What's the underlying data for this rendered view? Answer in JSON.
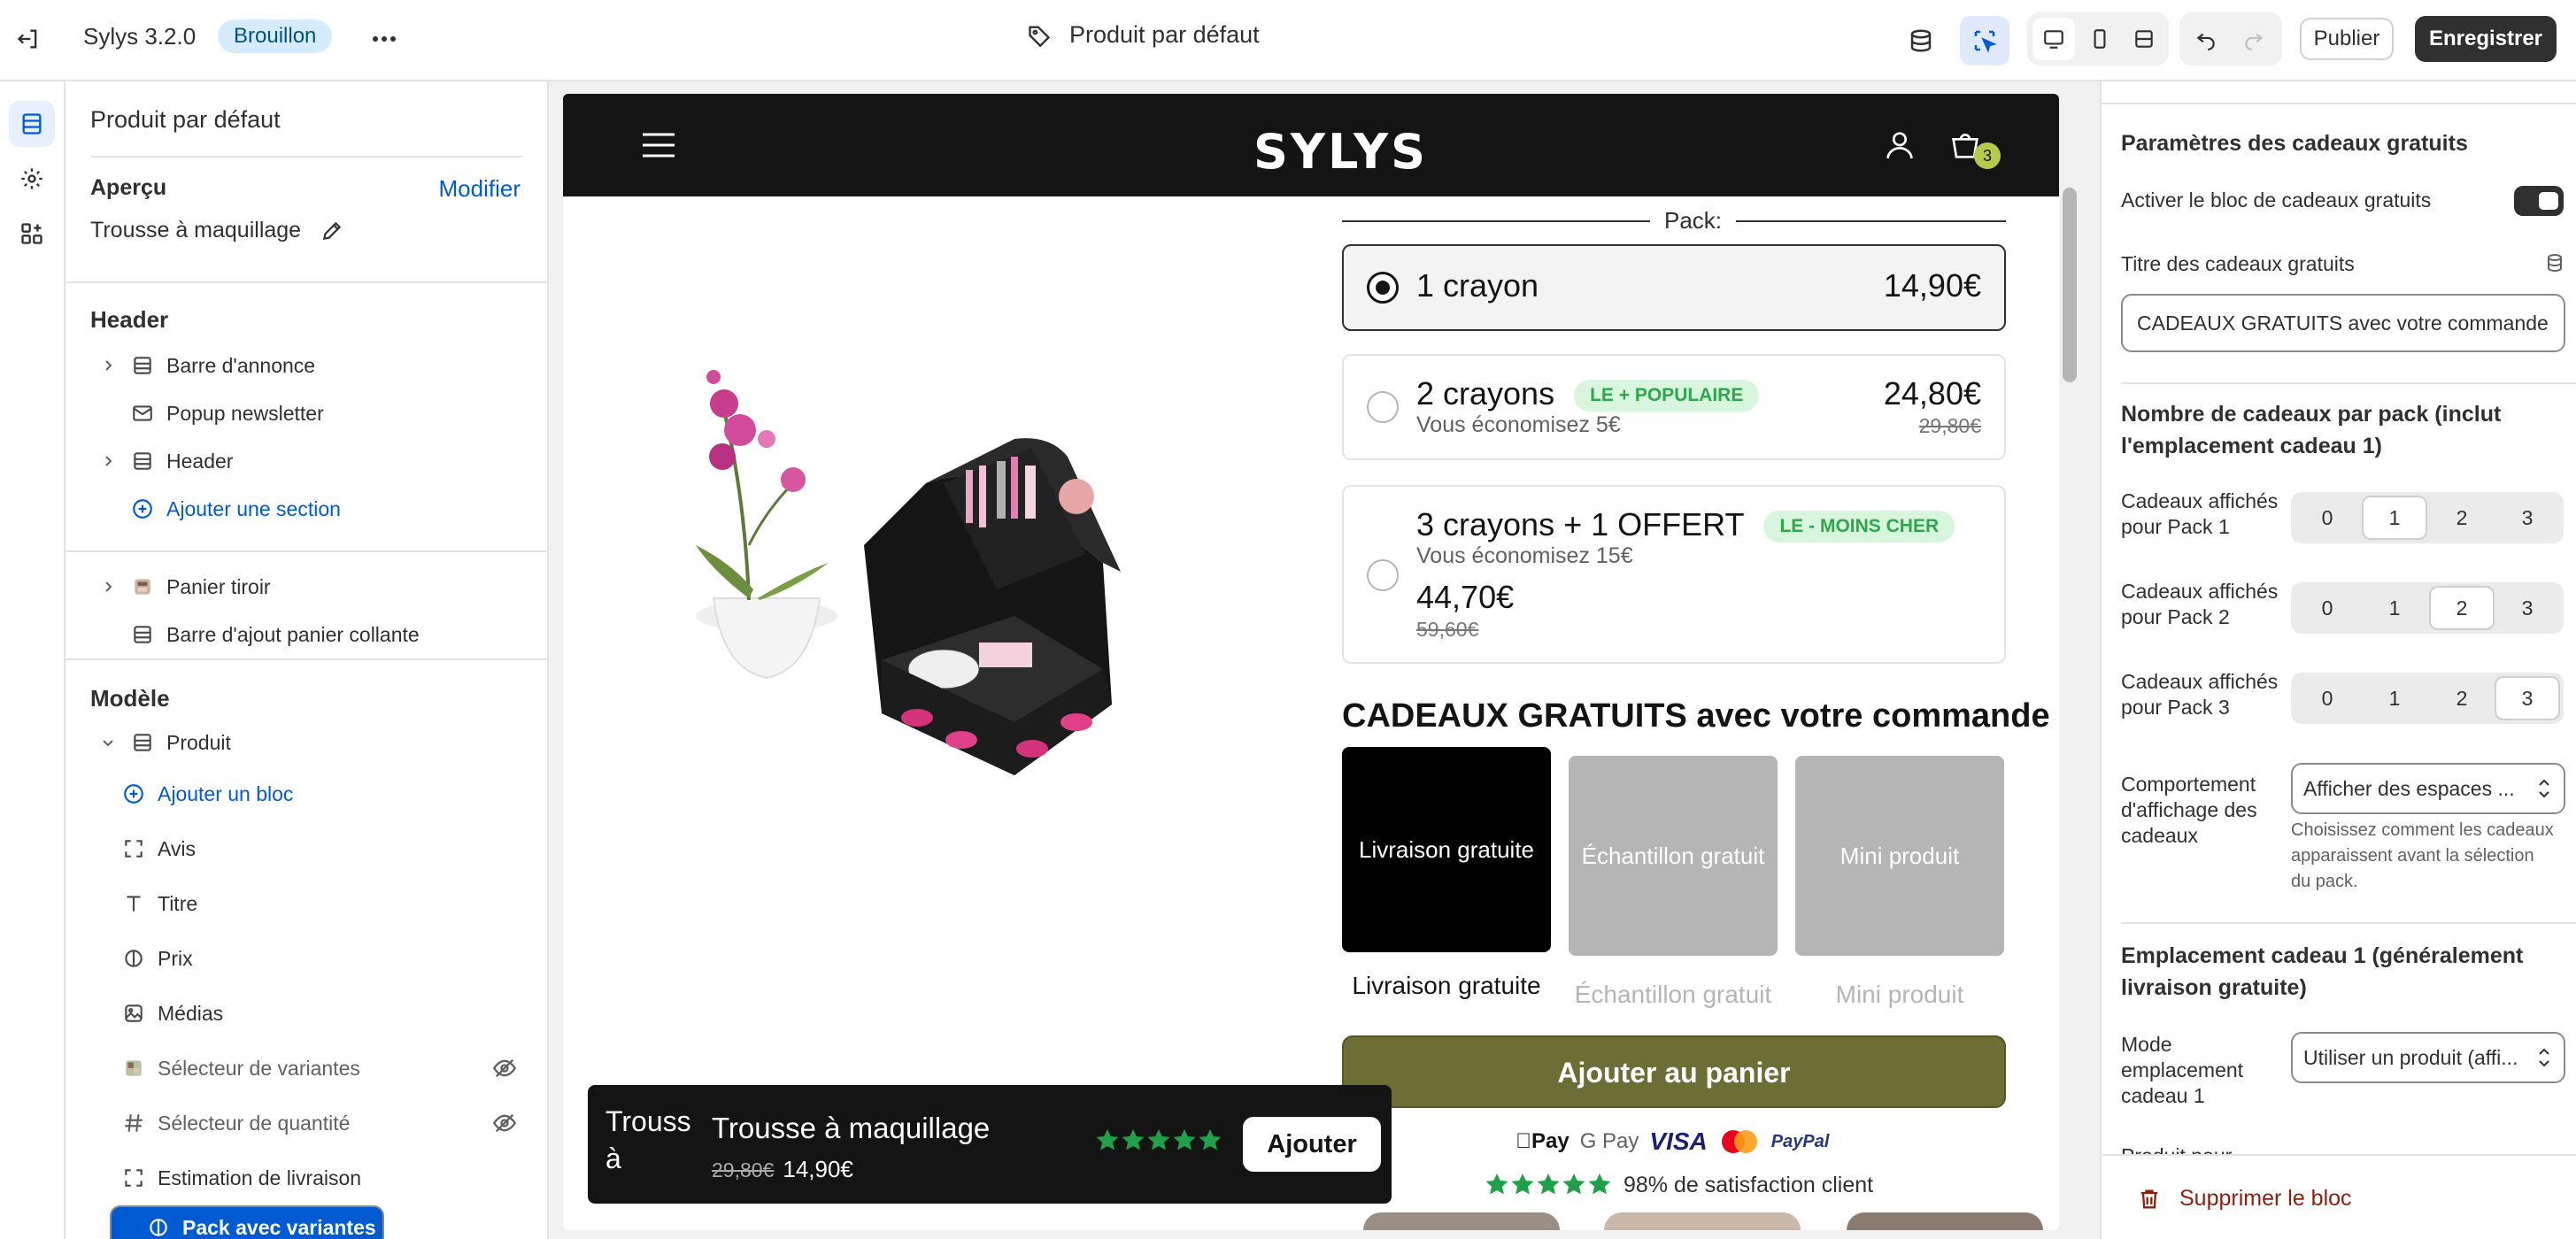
{
  "topbar": {
    "app_name": "Sylys 3.2.0",
    "status_badge": "Brouillon",
    "template_title": "Produit par défaut",
    "publish_label": "Publier",
    "save_label": "Enregistrer"
  },
  "sidebar": {
    "title": "Produit par défaut",
    "preview_heading": "Aperçu",
    "preview_modify": "Modifier",
    "preview_product": "Trousse à maquillage",
    "header_group": {
      "heading": "Header",
      "items": [
        {
          "label": "Barre d'annonce",
          "expandable": true,
          "icon": "section-icon"
        },
        {
          "label": "Popup newsletter",
          "expandable": false,
          "icon": "mail-icon"
        },
        {
          "label": "Header",
          "expandable": true,
          "icon": "section-icon"
        }
      ],
      "add_section": "Ajouter une section"
    },
    "extra_items": [
      {
        "label": "Panier tiroir",
        "expandable": true,
        "icon": "drawer-thumb-icon"
      },
      {
        "label": "Barre d'ajout panier collante",
        "expandable": false,
        "icon": "section-icon"
      }
    ],
    "template_group": {
      "heading": "Modèle",
      "product_label": "Produit",
      "add_block": "Ajouter un bloc",
      "blocks": [
        {
          "label": "Avis",
          "icon": "block-frame-icon",
          "hidden": false
        },
        {
          "label": "Titre",
          "icon": "text-icon",
          "hidden": false
        },
        {
          "label": "Prix",
          "icon": "price-tag-icon",
          "hidden": false
        },
        {
          "label": "Médias",
          "icon": "image-icon",
          "hidden": false
        },
        {
          "label": "Sélecteur de variantes",
          "icon": "variant-thumb-icon",
          "hidden": true
        },
        {
          "label": "Sélecteur de quantité",
          "icon": "hash-icon",
          "hidden": true
        },
        {
          "label": "Estimation de livraison",
          "icon": "block-frame-icon",
          "hidden": false
        },
        {
          "label": "Pack avec variantes",
          "icon": "price-tag-icon",
          "hidden": false,
          "selected": true
        }
      ]
    }
  },
  "preview": {
    "logo": "SYLYS",
    "cart_count": "3",
    "pack_label": "Pack:",
    "options": [
      {
        "title": "1 crayon",
        "price": "14,90€",
        "selected": true
      },
      {
        "title": "2 crayons",
        "tag": "LE + POPULAIRE",
        "subtitle": "Vous économisez 5€",
        "price": "24,80€",
        "old_price": "29,80€"
      },
      {
        "title": "3 crayons + 1 OFFERT",
        "tag": "LE - MOINS CHER",
        "subtitle": "Vous économisez 15€",
        "price": "44,70€",
        "old_price": "59,60€"
      }
    ],
    "gifts_title": "CADEAUX GRATUITS avec votre commande",
    "gifts": [
      {
        "label": "Livraison gratuite",
        "caption": "Livraison gratuite",
        "active": true
      },
      {
        "label": "Échantillon gratuit",
        "caption": "Échantillon gratuit",
        "active": false
      },
      {
        "label": "Mini produit",
        "caption": "Mini produit",
        "active": false
      }
    ],
    "add_to_cart": "Ajouter au panier",
    "payment_methods": [
      "Apple Pay",
      "G Pay",
      "VISA",
      "Mastercard",
      "PayPal"
    ],
    "satisfaction": "98% de satisfaction client",
    "sticky": {
      "short_title": "Trouss à",
      "product_name": "Trousse à maquillage",
      "old_price": "29,80€",
      "price": "14,90€",
      "rating": 5,
      "button": "Ajouter"
    }
  },
  "settings": {
    "section_title": "Paramètres des cadeaux gratuits",
    "enable_label": "Activer le bloc de cadeaux gratuits",
    "enable_value": true,
    "gifts_title_label": "Titre des cadeaux gratuits",
    "gifts_title_value": "CADEAUX GRATUITS avec votre commande",
    "per_pack_heading": "Nombre de cadeaux par pack (inclut l'emplacement cadeau 1)",
    "packs": [
      {
        "label": "Cadeaux affichés pour Pack 1",
        "options": [
          "0",
          "1",
          "2",
          "3"
        ],
        "selected": "1"
      },
      {
        "label": "Cadeaux affichés pour Pack 2",
        "options": [
          "0",
          "1",
          "2",
          "3"
        ],
        "selected": "2"
      },
      {
        "label": "Cadeaux affichés pour Pack 3",
        "options": [
          "0",
          "1",
          "2",
          "3"
        ],
        "selected": "3"
      }
    ],
    "display_label": "Comportement d'affichage des cadeaux",
    "display_value": "Afficher des espaces ...",
    "display_help": "Choisissez comment les cadeaux apparaissent avant la sélection du pack.",
    "slot1_heading": "Emplacement cadeau 1 (généralement livraison gratuite)",
    "slot1_mode_label": "Mode emplacement cadeau 1",
    "slot1_mode_value": "Utiliser un produit (affi...",
    "product_for_label": "Produit pour",
    "delete_label": "Supprimer le bloc"
  },
  "colors": {
    "accent_blue": "#005bd3",
    "dark": "#303030",
    "add_to_cart": "#6d6e36",
    "tag_green": "#2ea64b",
    "delete_red": "#8e1f0b"
  }
}
